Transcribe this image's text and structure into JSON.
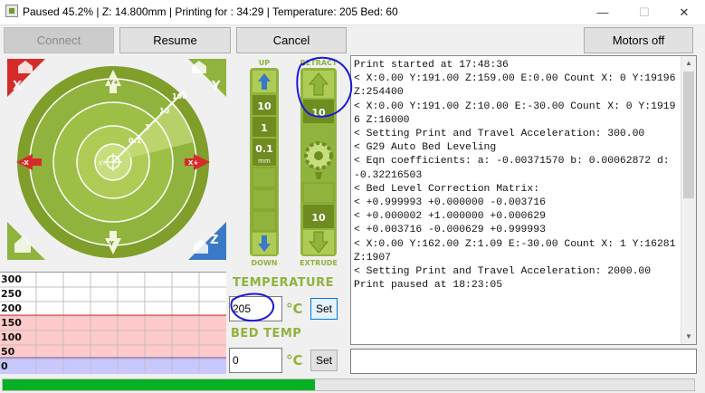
{
  "window": {
    "title": "Paused 45.2% | Z: 14.800mm | Printing for : 34:29  | Temperature: 205 Bed: 60",
    "min_glyph": "—",
    "max_glyph": "☐",
    "close_glyph": "✕"
  },
  "toolbar": {
    "connect_label": "Connect",
    "resume_label": "Resume",
    "cancel_label": "Cancel",
    "motors_off_label": "Motors off"
  },
  "jog": {
    "x_minus": "-X",
    "x_plus": "X+",
    "y_plus": "Y+",
    "y_minus": "-Y",
    "home_x": "X",
    "home_y": "Y",
    "home_z": "Z",
    "center": "XY",
    "steps": [
      "0.1",
      "1",
      "10",
      "100"
    ]
  },
  "z_panel": {
    "up": "UP",
    "down": "DOWN",
    "steps": [
      "10",
      "1",
      "0.1"
    ],
    "unit": "mm"
  },
  "extruder_panel": {
    "retract": "RETRACT",
    "extrude": "EXTRUDE",
    "top_value": "10",
    "bottom_value": "10"
  },
  "log": {
    "lines": [
      "Print started at 17:48:36",
      "< X:0.00 Y:191.00 Z:159.00 E:0.00 Count X: 0 Y:19196 Z:254400",
      "< X:0.00 Y:191.00 Z:10.00 E:-30.00 Count X: 0 Y:19196 Z:16000",
      "< Setting Print and Travel Acceleration: 300.00",
      "< G29 Auto Bed Leveling",
      "< Eqn coefficients: a: -0.00371570 b: 0.00062872 d: -0.32216503",
      "< Bed Level Correction Matrix:",
      "< +0.999993 +0.000000 -0.003716",
      "< +0.000002 +1.000000 +0.000629",
      "< +0.003716 -0.000629 +0.999993",
      "< X:0.00 Y:162.00 Z:1.09 E:-30.00 Count X: 1 Y:16281 Z:1907",
      "< Setting Print and Travel Acceleration: 2000.00",
      "Print paused at 18:23:05"
    ]
  },
  "temperature": {
    "title": "TEMPERATURE",
    "value": "205",
    "unit": "°C",
    "set_label": "Set"
  },
  "bed": {
    "title": "BED TEMP",
    "value": "0",
    "unit": "°C",
    "set_label": "Set"
  },
  "graph": {
    "y_labels": [
      "300",
      "250",
      "200",
      "150",
      "100",
      "50",
      "0"
    ]
  },
  "progress": {
    "fraction": 0.452
  },
  "colors": {
    "accent_green": "#8fb33c",
    "red": "#d62b2b",
    "blue": "#3a78c8",
    "progress_green": "#06b025",
    "annotation_blue": "#1a1ad8"
  }
}
